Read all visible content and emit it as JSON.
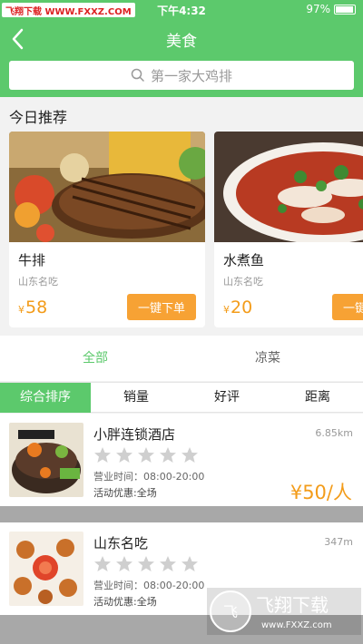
{
  "status": {
    "time": "下午4:32",
    "battery": "97%",
    "battery_level": 0.97
  },
  "watermark": {
    "top_text": "飞翔下载 WWW.FXXZ.COM",
    "logo_text": "飞翔下载",
    "logo_url": "www.FXXZ.com"
  },
  "nav": {
    "title": "美食",
    "back_icon": "chevron-left-icon"
  },
  "search": {
    "placeholder": "第一家大鸡排",
    "icon": "search-icon"
  },
  "recommend": {
    "title": "今日推荐",
    "cards": [
      {
        "name": "牛排",
        "sub": "山东名吃",
        "currency": "¥",
        "price": "58",
        "button": "一键下单"
      },
      {
        "name": "水煮鱼",
        "sub": "山东名吃",
        "currency": "¥",
        "price": "20",
        "button": "一键下单"
      }
    ]
  },
  "category_tabs": [
    {
      "label": "全部",
      "active": true
    },
    {
      "label": "凉菜",
      "active": false
    }
  ],
  "sort": [
    {
      "label": "综合排序",
      "active": true
    },
    {
      "label": "销量",
      "active": false
    },
    {
      "label": "好评",
      "active": false
    },
    {
      "label": "距离",
      "active": false
    }
  ],
  "shops": [
    {
      "name": "小胖连锁酒店",
      "distance": "6.85km",
      "rating": 0,
      "hours": "营业时间：08:00-20:00",
      "promo": "活动优惠:全场",
      "avg": "¥50/人"
    },
    {
      "name": "山东名吃",
      "distance": "347m",
      "rating": 0,
      "hours": "营业时间：08:00-20:00",
      "promo": "活动优惠:全场",
      "avg": ""
    }
  ],
  "colors": {
    "brand": "#5cc96c",
    "price": "#f39c1a",
    "button": "#f7a234",
    "star": "#cfcfcf"
  }
}
